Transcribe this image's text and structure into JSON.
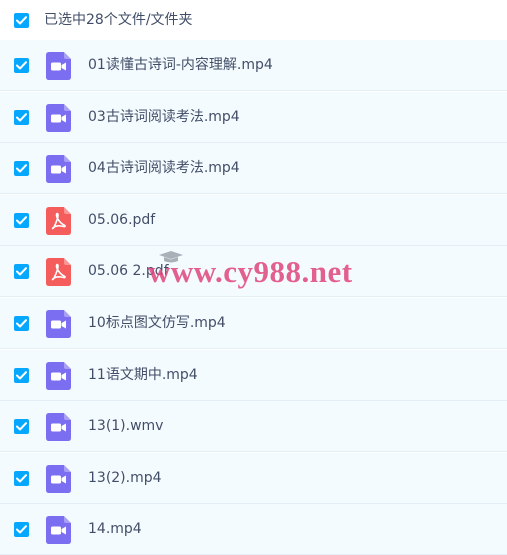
{
  "header": {
    "selection_text": "已选中28个文件/文件夹"
  },
  "files": [
    {
      "name": "01读懂古诗词-内容理解.mp4",
      "type": "video",
      "icon": "video-file-icon"
    },
    {
      "name": "03古诗词阅读考法.mp4",
      "type": "video",
      "icon": "video-file-icon"
    },
    {
      "name": "04古诗词阅读考法.mp4",
      "type": "video",
      "icon": "video-file-icon"
    },
    {
      "name": "05.06.pdf",
      "type": "pdf",
      "icon": "pdf-file-icon"
    },
    {
      "name": "05.06 2.pdf",
      "type": "pdf",
      "icon": "pdf-file-icon"
    },
    {
      "name": "10标点图文仿写.mp4",
      "type": "video",
      "icon": "video-file-icon"
    },
    {
      "name": "11语文期中.mp4",
      "type": "video",
      "icon": "video-file-icon"
    },
    {
      "name": "13(1).wmv",
      "type": "video",
      "icon": "video-file-icon"
    },
    {
      "name": "13(2).mp4",
      "type": "video",
      "icon": "video-file-icon"
    },
    {
      "name": "14.mp4",
      "type": "video",
      "icon": "video-file-icon"
    }
  ],
  "watermark": {
    "text": "www.cy988.net"
  },
  "colors": {
    "checkbox": "#06a7ff",
    "video_icon": "#7c6ef0",
    "pdf_icon": "#f55c5c",
    "row_background": "#f4fbff",
    "text": "#424e67",
    "watermark": "#e0457b"
  }
}
